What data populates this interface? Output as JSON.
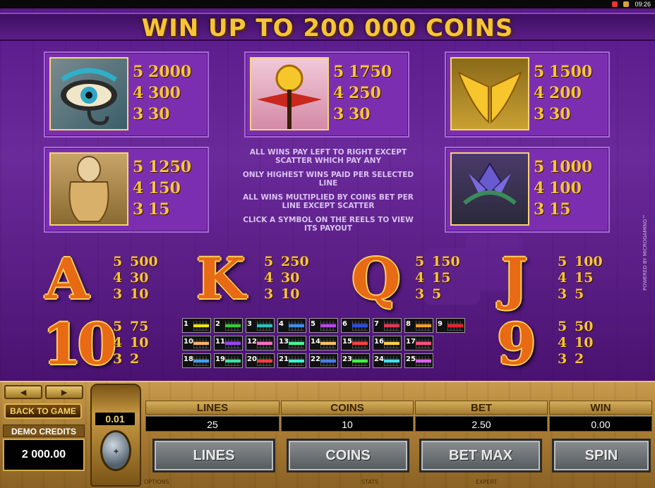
{
  "status": {
    "time": "09:26"
  },
  "banner": {
    "title": "WIN UP TO 200 000 COINS"
  },
  "symbols": [
    {
      "name": "eye",
      "pays": [
        [
          "5",
          "2000"
        ],
        [
          "4",
          "300"
        ],
        [
          "3",
          "30"
        ]
      ]
    },
    {
      "name": "sun-disk",
      "pays": [
        [
          "5",
          "1750"
        ],
        [
          "4",
          "250"
        ],
        [
          "3",
          "30"
        ]
      ]
    },
    {
      "name": "wings",
      "pays": [
        [
          "5",
          "1500"
        ],
        [
          "4",
          "200"
        ],
        [
          "3",
          "30"
        ]
      ]
    },
    {
      "name": "canopic-jar",
      "pays": [
        [
          "5",
          "1250"
        ],
        [
          "4",
          "150"
        ],
        [
          "3",
          "15"
        ]
      ]
    },
    {
      "name": "lotus",
      "pays": [
        [
          "5",
          "1000"
        ],
        [
          "4",
          "100"
        ],
        [
          "3",
          "15"
        ]
      ]
    }
  ],
  "rules": [
    "ALL WINS PAY LEFT TO RIGHT EXCEPT SCATTER WHICH PAY ANY",
    "ONLY HIGHEST WINS PAID PER SELECTED LINE",
    "ALL WINS MULTIPLIED BY COINS BET PER LINE EXCEPT SCATTER",
    "CLICK A SYMBOL ON THE REELS TO VIEW ITS PAYOUT"
  ],
  "cards": [
    {
      "letter": "A",
      "pays": [
        [
          "5",
          "500"
        ],
        [
          "4",
          "30"
        ],
        [
          "3",
          "10"
        ]
      ]
    },
    {
      "letter": "K",
      "pays": [
        [
          "5",
          "250"
        ],
        [
          "4",
          "30"
        ],
        [
          "3",
          "10"
        ]
      ]
    },
    {
      "letter": "Q",
      "pays": [
        [
          "5",
          "150"
        ],
        [
          "4",
          "15"
        ],
        [
          "3",
          "5"
        ]
      ]
    },
    {
      "letter": "J",
      "pays": [
        [
          "5",
          "100"
        ],
        [
          "4",
          "15"
        ],
        [
          "3",
          "5"
        ]
      ]
    },
    {
      "letter": "10",
      "pays": [
        [
          "5",
          "75"
        ],
        [
          "4",
          "10"
        ],
        [
          "3",
          "2"
        ]
      ]
    },
    {
      "letter": "9",
      "pays": [
        [
          "5",
          "50"
        ],
        [
          "4",
          "10"
        ],
        [
          "3",
          "2"
        ]
      ]
    }
  ],
  "paylines": [
    {
      "n": "1",
      "c": "#f5e400"
    },
    {
      "n": "2",
      "c": "#2ed12e"
    },
    {
      "n": "3",
      "c": "#1fc6c6"
    },
    {
      "n": "4",
      "c": "#3b8cff"
    },
    {
      "n": "5",
      "c": "#c040ff"
    },
    {
      "n": "6",
      "c": "#2050ff"
    },
    {
      "n": "7",
      "c": "#ff3050"
    },
    {
      "n": "8",
      "c": "#ffa020"
    },
    {
      "n": "9",
      "c": "#ff2020"
    },
    {
      "n": "10",
      "c": "#ffb070"
    },
    {
      "n": "11",
      "c": "#a040ff"
    },
    {
      "n": "12",
      "c": "#ff70d0"
    },
    {
      "n": "13",
      "c": "#40ff90"
    },
    {
      "n": "14",
      "c": "#ffc060"
    },
    {
      "n": "15",
      "c": "#ff4040"
    },
    {
      "n": "16",
      "c": "#ffd040"
    },
    {
      "n": "17",
      "c": "#ff5080"
    },
    {
      "n": "18",
      "c": "#40a0ff"
    },
    {
      "n": "19",
      "c": "#40e0a0"
    },
    {
      "n": "20",
      "c": "#ff4040"
    },
    {
      "n": "21",
      "c": "#40ffd0"
    },
    {
      "n": "22",
      "c": "#4080ff"
    },
    {
      "n": "23",
      "c": "#40ff40"
    },
    {
      "n": "24",
      "c": "#40e0ff"
    },
    {
      "n": "25",
      "c": "#e060ff"
    }
  ],
  "watermark": "POWERED BY MICROGAMING™",
  "console": {
    "back_label": "BACK TO GAME",
    "prev_icon": "◄",
    "next_icon": "►",
    "credits_label": "DEMO CREDITS",
    "credits_value": "2 000.00",
    "coin_value": "0.01",
    "fields": [
      {
        "label": "LINES",
        "value": "25"
      },
      {
        "label": "COINS",
        "value": "10"
      },
      {
        "label": "BET",
        "value": "2.50"
      },
      {
        "label": "WIN",
        "value": "0.00"
      }
    ],
    "buttons": {
      "lines": "LINES",
      "coins": "COINS",
      "betmax": "BET MAX",
      "spin": "SPIN"
    },
    "footer": {
      "options": "OPTIONS",
      "stats": "STATS",
      "expert": "EXPERT"
    }
  }
}
